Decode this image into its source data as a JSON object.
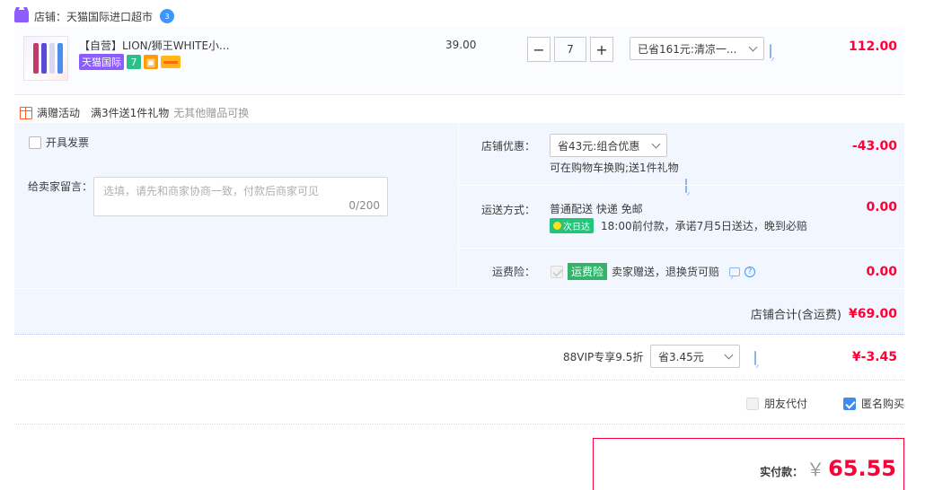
{
  "shop": {
    "label": "店铺：天猫国际进口超市",
    "ww": "3"
  },
  "product": {
    "title": "【自营】LION/狮王WHITE小...",
    "tag_tmall": "天猫国际",
    "tag_seven": "7",
    "unit_price": "39.00",
    "qty": "7",
    "discount_select": "已省161元:清凉一...",
    "total": "112.00"
  },
  "gift": {
    "label": "满赠活动",
    "desc": "满3件送1件礼物",
    "note": "无其他赠品可换"
  },
  "invoice": {
    "label": "开具发票"
  },
  "message": {
    "label": "给卖家留言：",
    "placeholder": "选填，请先和商家协商一致，付款后商家可见",
    "count": "0/200"
  },
  "shop_discount": {
    "label": "店铺优惠：",
    "select": "省43元:组合优惠",
    "desc": "可在购物车换购;送1件礼物",
    "amount": "-43.00"
  },
  "shipping": {
    "label": "运送方式：",
    "method": "普通配送 快递 免邮",
    "badge": "次日达",
    "promise": "18:00前付款，承诺7月5日送达，晚到必赔",
    "amount": "0.00"
  },
  "freight_insurance": {
    "label": "运费险：",
    "tag": "运费险",
    "desc": "卖家赠送，退换货可赔",
    "help": "?",
    "amount": "0.00"
  },
  "shop_total": {
    "label": "店铺合计(含运费)",
    "amount": "¥69.00"
  },
  "vip": {
    "label": "88VIP专享9.5折",
    "select": "省3.45元",
    "amount": "¥-3.45"
  },
  "options": {
    "friend_pay": "朋友代付",
    "anonymous": "匿名购买"
  },
  "payment": {
    "label": "实付款：",
    "currency": "￥",
    "amount": "65.55"
  },
  "colors": {
    "accent_red": "#ff0036",
    "tmall_purple": "#8c5cff",
    "panel_bg": "#f2f7ff"
  }
}
